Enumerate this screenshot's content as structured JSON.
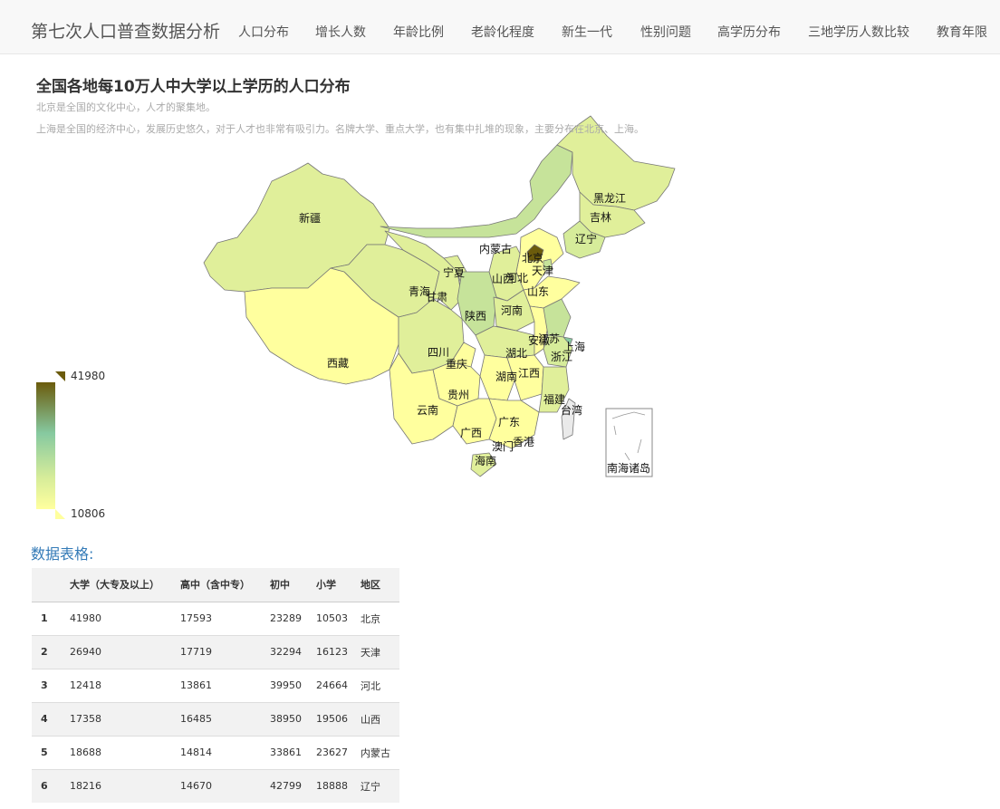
{
  "nav": {
    "brand": "第七次人口普查数据分析",
    "items": [
      "人口分布",
      "增长人数",
      "年龄比例",
      "老龄化程度",
      "新生一代",
      "性别问题",
      "高学历分布",
      "三地学历人数比较",
      "教育年限"
    ]
  },
  "chart": {
    "title": "全国各地每10万人中大学以上学历的人口分布",
    "subtitle_lines": [
      "北京是全国的文化中心，人才的聚集地。",
      "上海是全国的经济中心，发展历史悠久，对于人才也非常有吸引力。名牌大学、重点大学，也有集中扎堆的现象，主要分布在北京、上海。"
    ],
    "visual_map": {
      "max": "41980",
      "min": "10806"
    },
    "inset_label": "南海诸岛",
    "colors": {
      "low": "#ffff9e",
      "mid_low": "#e0ef9a",
      "mid": "#c6e39a",
      "high": "#86c9a0",
      "top": "#6b5b0c"
    }
  },
  "chart_data": {
    "type": "map",
    "title": "全国各地每10万人中大学以上学历的人口分布",
    "value_range": [
      10806,
      41980
    ],
    "regions": [
      {
        "name": "北京",
        "value": 41980
      },
      {
        "name": "天津",
        "value": 26940
      },
      {
        "name": "河北",
        "value": 12418
      },
      {
        "name": "山西",
        "value": 17358
      },
      {
        "name": "内蒙古",
        "value": 18688
      },
      {
        "name": "辽宁",
        "value": 18216
      }
    ],
    "map_labels": [
      "新疆",
      "西藏",
      "青海",
      "甘肃",
      "宁夏",
      "内蒙古",
      "黑龙江",
      "吉林",
      "辽宁",
      "北京",
      "天津",
      "河北",
      "山西",
      "山东",
      "陕西",
      "河南",
      "四川",
      "重庆",
      "湖北",
      "安徽",
      "江苏",
      "上海",
      "浙江",
      "湖南",
      "江西",
      "贵州",
      "云南",
      "广西",
      "广东",
      "福建",
      "台湾",
      "澳门",
      "香港",
      "海南"
    ]
  },
  "table": {
    "section_title": "数据表格:",
    "headers": [
      "",
      "大学（大专及以上）",
      "高中（含中专）",
      "初中",
      "小学",
      "地区"
    ],
    "rows": [
      [
        "1",
        "41980",
        "17593",
        "23289",
        "10503",
        "北京"
      ],
      [
        "2",
        "26940",
        "17719",
        "32294",
        "16123",
        "天津"
      ],
      [
        "3",
        "12418",
        "13861",
        "39950",
        "24664",
        "河北"
      ],
      [
        "4",
        "17358",
        "16485",
        "38950",
        "19506",
        "山西"
      ],
      [
        "5",
        "18688",
        "14814",
        "33861",
        "23627",
        "内蒙古"
      ],
      [
        "6",
        "18216",
        "14670",
        "42799",
        "18888",
        "辽宁"
      ]
    ]
  }
}
